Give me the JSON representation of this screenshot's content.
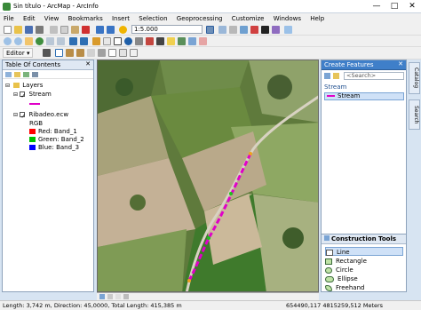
{
  "window": {
    "title": "Sin título - ArcMap - ArcInfo",
    "minimize": "—",
    "maximize": "□",
    "close": "✕"
  },
  "menu": [
    "File",
    "Edit",
    "View",
    "Bookmarks",
    "Insert",
    "Selection",
    "Geoprocessing",
    "Customize",
    "Windows",
    "Help"
  ],
  "toolbar": {
    "scale": "1:5.000",
    "editor_label": "Editor ▾"
  },
  "toc": {
    "title": "Table Of Contents",
    "layers_label": "Layers",
    "stream_layer": "Stream",
    "raster_layer": "Ribadeo.ecw",
    "rgb_label": "RGB",
    "bands": [
      {
        "label": "Red:",
        "band": "Band_1",
        "color": "#ff0000"
      },
      {
        "label": "Green:",
        "band": "Band_2",
        "color": "#00c000"
      },
      {
        "label": "Blue:",
        "band": "Band_3",
        "color": "#0000ff"
      }
    ]
  },
  "create_features": {
    "title": "Create Features",
    "search_placeholder": "<Search>",
    "group": "Stream",
    "template": "Stream"
  },
  "construction_tools": {
    "title": "Construction Tools",
    "tools": [
      "Line",
      "Rectangle",
      "Circle",
      "Ellipse",
      "Freehand"
    ]
  },
  "side_tabs": [
    "Catalog",
    "Search"
  ],
  "status": {
    "left": "Length: 3,742 m, Direction: 45,0000, Total Length: 415,385 m",
    "coords": "654490,117  4815259,512 Meters"
  },
  "colors": {
    "stream": "#e000c8",
    "accent": "#2f6fb3"
  }
}
